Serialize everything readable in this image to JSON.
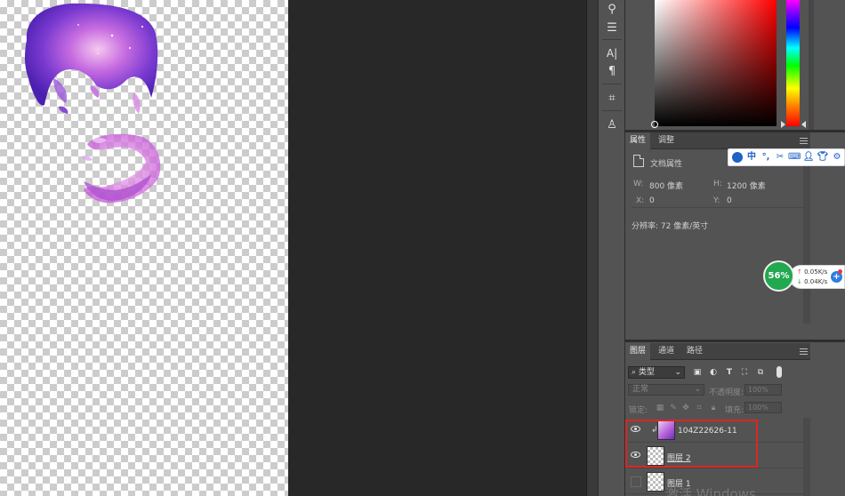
{
  "canvas": {
    "artwork": "galaxy-portrait-cutout"
  },
  "toolbar": {
    "tools": [
      {
        "name": "brush-settings-icon",
        "glyph": "⚲"
      },
      {
        "name": "sliders-icon",
        "glyph": "☰"
      },
      {
        "name": "character-icon",
        "glyph": "A|"
      },
      {
        "name": "paragraph-icon",
        "glyph": "¶"
      },
      {
        "name": "crop-icon",
        "glyph": "⌗"
      },
      {
        "name": "clone-source-icon",
        "glyph": "♙"
      }
    ]
  },
  "color_picker": {
    "base_color": "#ff0000"
  },
  "properties": {
    "tabs": [
      "属性",
      "调整"
    ],
    "active_tab": "属性",
    "section_title": "文档属性",
    "width_label": "W:",
    "width_value": "800 像素",
    "height_label": "H:",
    "height_value": "1200 像素",
    "x_label": "X:",
    "x_value": "0",
    "y_label": "Y:",
    "y_value": "0",
    "resolution": "分辨率: 72 像素/英寸"
  },
  "layers": {
    "tabs": [
      "图层",
      "通道",
      "路径"
    ],
    "active_tab": "图层",
    "filter_label": "类型",
    "blend_mode": "正常",
    "opacity_label": "不透明度:",
    "opacity_value": "100%",
    "lock_label": "锁定:",
    "fill_label": "填充:",
    "fill_value": "100%",
    "items": [
      {
        "name": "104Z22626-11",
        "visible": true,
        "clipped": true,
        "selected": true
      },
      {
        "name": "图层 2",
        "visible": true,
        "clipped": false,
        "selected": true
      },
      {
        "name": "图层 1",
        "visible": false,
        "clipped": false,
        "selected": false
      }
    ],
    "highlight_color": "#e02424"
  },
  "ime": {
    "items": [
      "ime-logo-icon",
      "中",
      "°,",
      "scissors-icon",
      "keyboard-icon",
      "user-icon",
      "shirt-icon",
      "gear-icon"
    ]
  },
  "net_monitor": {
    "cpu": "56%",
    "upload": "0.05K/s",
    "download": "0.04K/s"
  },
  "watermark": "激活 Windows"
}
